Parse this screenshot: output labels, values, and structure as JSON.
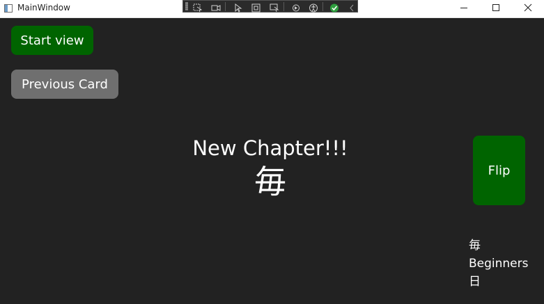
{
  "window": {
    "title": "MainWindow",
    "background": "#222222"
  },
  "debug_toolbar": {
    "icons": [
      "select-element-icon",
      "video-icon",
      "cursor-icon",
      "box-icon",
      "track-focus-icon",
      "hot-reload-icon",
      "accessibility-icon",
      "check-icon",
      "collapse-chevron-icon"
    ]
  },
  "window_controls": {
    "icons": [
      "minimize-icon",
      "maximize-icon",
      "close-icon"
    ]
  },
  "buttons": {
    "start_view": "Start view",
    "previous_card": "Previous Card",
    "flip": "Flip",
    "start_color": "#006400",
    "previous_color": "#6f6f6f",
    "flip_color": "#006400"
  },
  "card": {
    "title": "New Chapter!!!",
    "kanji": "毎"
  },
  "side_info": {
    "kanji": "毎",
    "level": "Beginners",
    "reading": "日"
  }
}
